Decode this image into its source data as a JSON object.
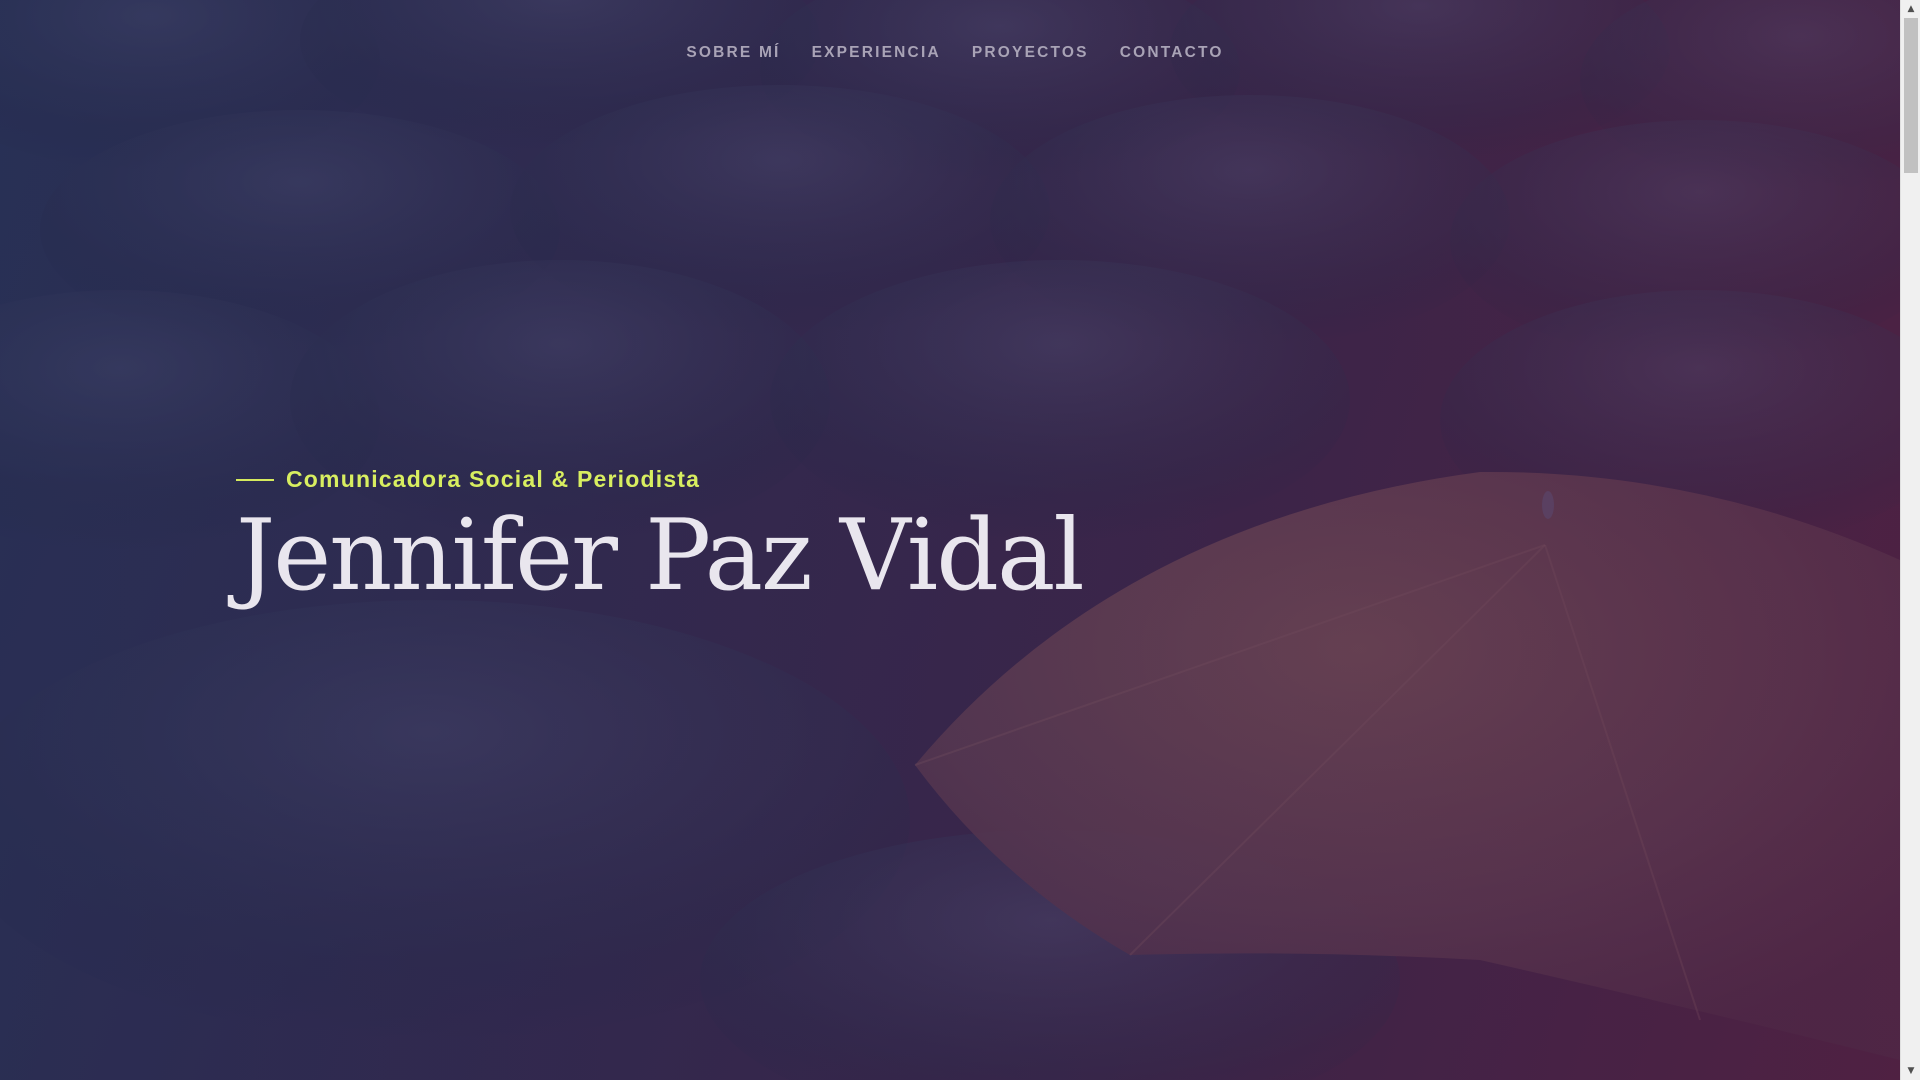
{
  "nav": {
    "items": [
      {
        "label": "SOBRE MÍ"
      },
      {
        "label": "EXPERIENCIA"
      },
      {
        "label": "PROYECTOS"
      },
      {
        "label": "CONTACTO"
      }
    ]
  },
  "hero": {
    "tagline": "Comunicadora Social & Periodista",
    "title": "Jennifer Paz Vidal",
    "background": "umbrellas-photo"
  },
  "colors": {
    "accent": "#d8ee60",
    "title": "#e9e6ee",
    "nav": "#a9a3b6"
  },
  "scrollbar": {
    "up_icon": "▲",
    "down_icon": "▼"
  }
}
